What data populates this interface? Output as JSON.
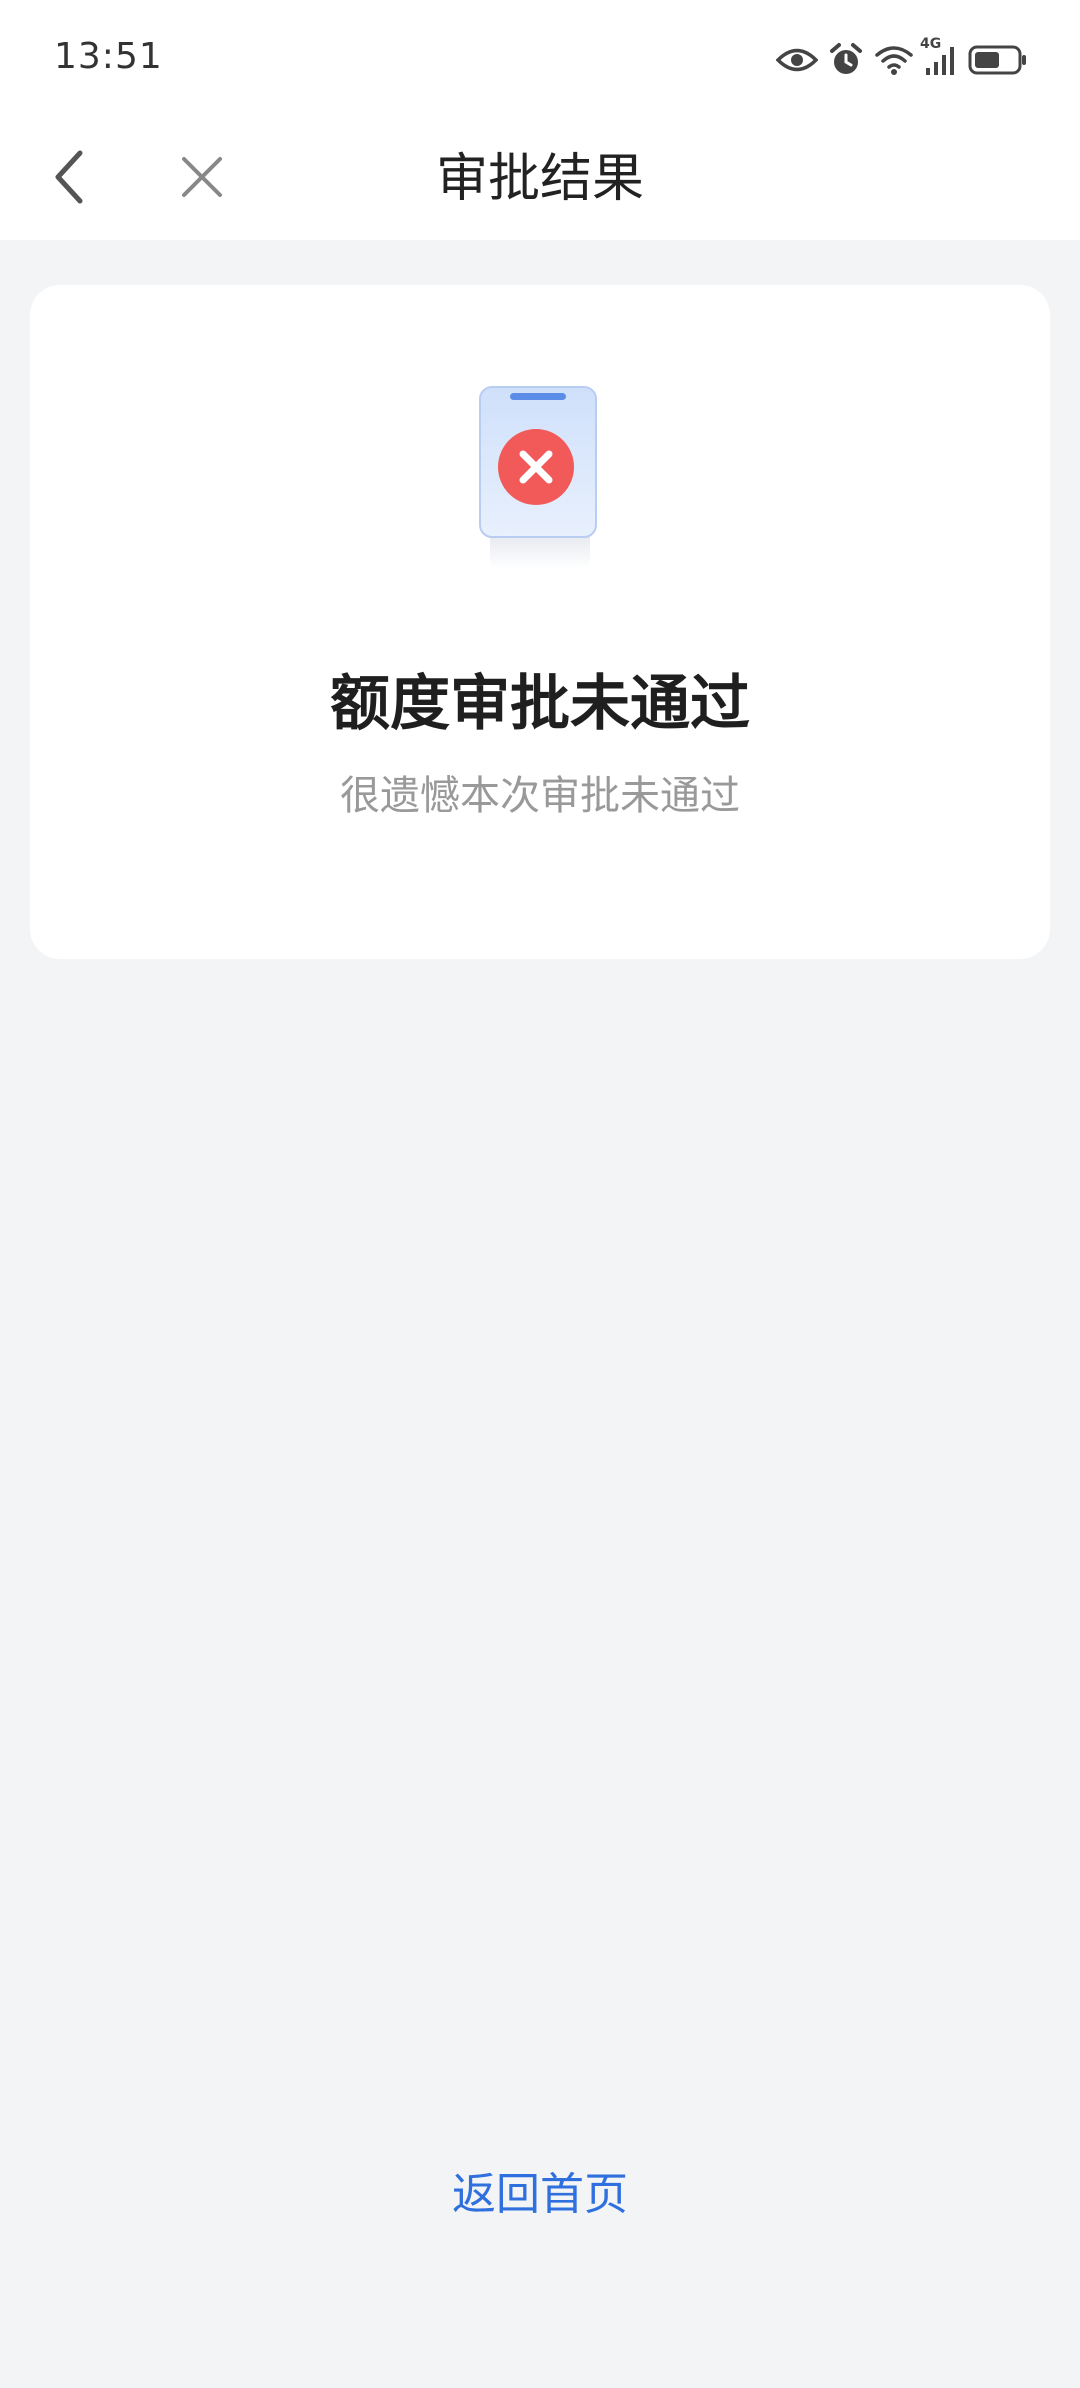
{
  "status_bar": {
    "time": "13:51",
    "network": "4G",
    "icons": [
      "eye-icon",
      "alarm-icon",
      "wifi-icon",
      "signal-icon",
      "battery-icon"
    ]
  },
  "nav": {
    "title": "审批结果",
    "back_icon": "chevron-left-icon",
    "close_icon": "close-icon"
  },
  "result": {
    "status": "rejected",
    "title": "额度审批未通过",
    "subtitle": "很遗憾本次审批未通过",
    "icon": "phone-reject-icon",
    "icon_color": "#f25a5a"
  },
  "footer": {
    "home_link": "返回首页",
    "link_color": "#2f6fde"
  }
}
